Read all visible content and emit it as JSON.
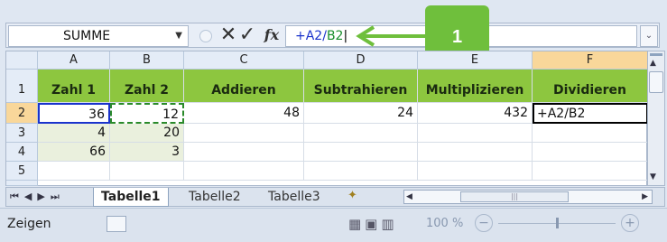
{
  "formula_bar": {
    "name_box": "SUMME",
    "cancel_glyph": "✕",
    "enter_glyph": "✓",
    "fx_label": "fx",
    "formula_prefix": "+A2/",
    "formula_ref": "B2"
  },
  "callout": {
    "number": "1",
    "color": "#6fbf3c"
  },
  "columns": [
    "A",
    "B",
    "C",
    "D",
    "E",
    "F"
  ],
  "rows": [
    "1",
    "2",
    "3",
    "4",
    "5"
  ],
  "header_row": [
    "Zahl 1",
    "Zahl 2",
    "Addieren",
    "Subtrahieren",
    "Multiplizieren",
    "Dividieren"
  ],
  "row2": [
    "36",
    "12",
    "48",
    "24",
    "432",
    "+A2/B2"
  ],
  "row3": [
    "4",
    "20"
  ],
  "row4": [
    "66",
    "3"
  ],
  "sheets": {
    "tab1": "Tabelle1",
    "tab2": "Tabelle2",
    "tab3": "Tabelle3"
  },
  "status": {
    "mode": "Zeigen",
    "zoom": "100 %"
  },
  "accent": "#8dc63f"
}
